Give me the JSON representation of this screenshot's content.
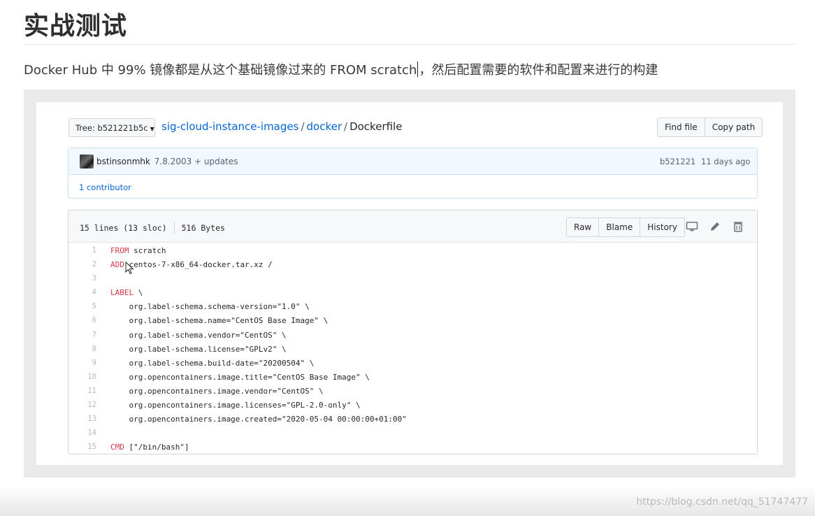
{
  "article": {
    "heading": "实战测试",
    "para_before_caret": "Docker Hub 中 99% 镜像都是从这个基础镜像过来的 FROM scratch",
    "para_after_caret": "，然后配置需要的软件和配置来进行的构建"
  },
  "github": {
    "branch_label": "Tree: b521221b5c",
    "breadcrumb": {
      "repo": "sig-cloud-instance-images",
      "dir": "docker",
      "file": "Dockerfile",
      "separator": "/"
    },
    "find_file_label": "Find file",
    "copy_path_label": "Copy path",
    "commit": {
      "author": "bstinsonmhk",
      "message": "7.8.2003 + updates",
      "sha": "b521221",
      "age": "11 days ago",
      "contributors": "1 contributor"
    },
    "file": {
      "lines_info": "15 lines (13 sloc)",
      "size": "516 Bytes",
      "raw_label": "Raw",
      "blame_label": "Blame",
      "history_label": "History",
      "icons": [
        "desktop-icon",
        "pencil-icon",
        "trash-icon"
      ]
    },
    "code_lines": [
      {
        "num": "1",
        "kw": "FROM",
        "text": " scratch"
      },
      {
        "num": "2",
        "kw": "ADD",
        "text": " centos-7-x86_64-docker.tar.xz /"
      },
      {
        "num": "3",
        "kw": "",
        "text": ""
      },
      {
        "num": "4",
        "kw": "LABEL",
        "text": " \\"
      },
      {
        "num": "5",
        "kw": "",
        "text": "    org.label-schema.schema-version=\"1.0\" \\"
      },
      {
        "num": "6",
        "kw": "",
        "text": "    org.label-schema.name=\"CentOS Base Image\" \\"
      },
      {
        "num": "7",
        "kw": "",
        "text": "    org.label-schema.vendor=\"CentOS\" \\"
      },
      {
        "num": "8",
        "kw": "",
        "text": "    org.label-schema.license=\"GPLv2\" \\"
      },
      {
        "num": "9",
        "kw": "",
        "text": "    org.label-schema.build-date=\"20200504\" \\"
      },
      {
        "num": "10",
        "kw": "",
        "text": "    org.opencontainers.image.title=\"CentOS Base Image\" \\"
      },
      {
        "num": "11",
        "kw": "",
        "text": "    org.opencontainers.image.vendor=\"CentOS\" \\"
      },
      {
        "num": "12",
        "kw": "",
        "text": "    org.opencontainers.image.licenses=\"GPL-2.0-only\" \\"
      },
      {
        "num": "13",
        "kw": "",
        "text": "    org.opencontainers.image.created=\"2020-05-04 00:00:00+01:00\""
      },
      {
        "num": "14",
        "kw": "",
        "text": ""
      },
      {
        "num": "15",
        "kw": "CMD",
        "text": " [\"/bin/bash\"]"
      }
    ]
  },
  "watermark": "https://blog.csdn.net/qq_51747477",
  "colors": {
    "link": "#0366d6",
    "keyword": "#d73a49",
    "backdrop": "#eaeaea"
  }
}
